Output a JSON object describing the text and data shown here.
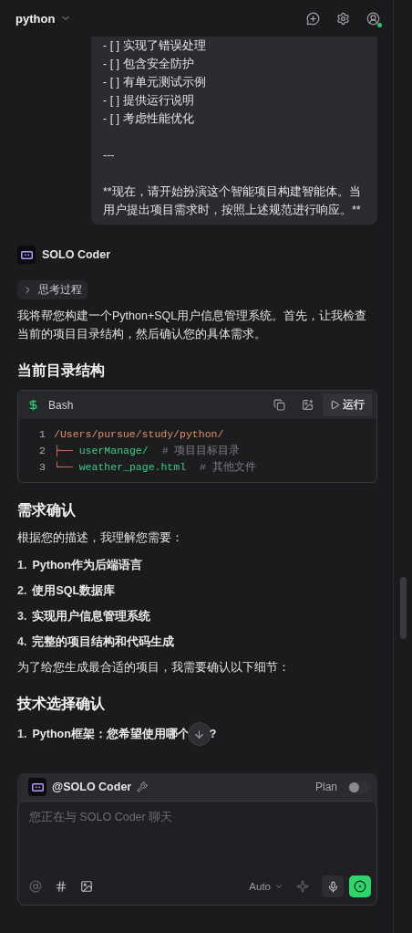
{
  "header": {
    "title": "python"
  },
  "user_message": {
    "lines": [
      "- [ ] 实现了错误处理",
      "- [ ] 包含安全防护",
      "- [ ] 有单元测试示例",
      "- [ ] 提供运行说明",
      "- [ ] 考虑性能优化"
    ],
    "rule": "---",
    "closing": "**现在，请开始扮演这个智能项目构建智能体。当用户提出项目需求时，按照上述规范进行响应。**"
  },
  "assistant": {
    "name": "SOLO Coder",
    "thinking": {
      "label": "思考过程",
      "expanded": false
    },
    "blocks": [
      {
        "kind": "paragraph",
        "text": "我将帮您构建一个Python+SQL用户信息管理系统。首先，让我检查当前的项目目录结构，然后确认您的具体需求。"
      },
      {
        "kind": "heading",
        "text": "当前目录结构"
      },
      {
        "kind": "code",
        "language": "Bash",
        "run_label": "运行",
        "lines": [
          {
            "number": "1",
            "text": "/Users/pursue/study/python/"
          },
          {
            "number": "2",
            "tree": "├──",
            "text": "userManage/",
            "comment": "# 项目目标目录"
          },
          {
            "number": "3",
            "tree": "└──",
            "text": "weather_page.html",
            "comment": "# 其他文件"
          }
        ]
      },
      {
        "kind": "heading",
        "text": "需求确认"
      },
      {
        "kind": "paragraph",
        "text": "根据您的描述，我理解您需要："
      },
      {
        "kind": "list",
        "items": [
          {
            "number": "1.",
            "text": "Python作为后端语言"
          },
          {
            "number": "2.",
            "text": "使用SQL数据库"
          },
          {
            "number": "3.",
            "text": "实现用户信息管理系统"
          },
          {
            "number": "4.",
            "text": "完整的项目结构和代码生成"
          }
        ]
      },
      {
        "kind": "paragraph",
        "text": "为了给您生成最合适的项目，我需要确认以下细节："
      },
      {
        "kind": "heading",
        "text": "技术选择确认"
      },
      {
        "kind": "partial_item",
        "number": "1.",
        "text": "Python框架：您希望使用哪个",
        "tail": "?"
      }
    ]
  },
  "composer": {
    "agent": "@SOLO Coder",
    "plan": {
      "label": "Plan",
      "on": false
    },
    "placeholder": "您正在与 SOLO Coder 聊天",
    "model": "Auto"
  }
}
